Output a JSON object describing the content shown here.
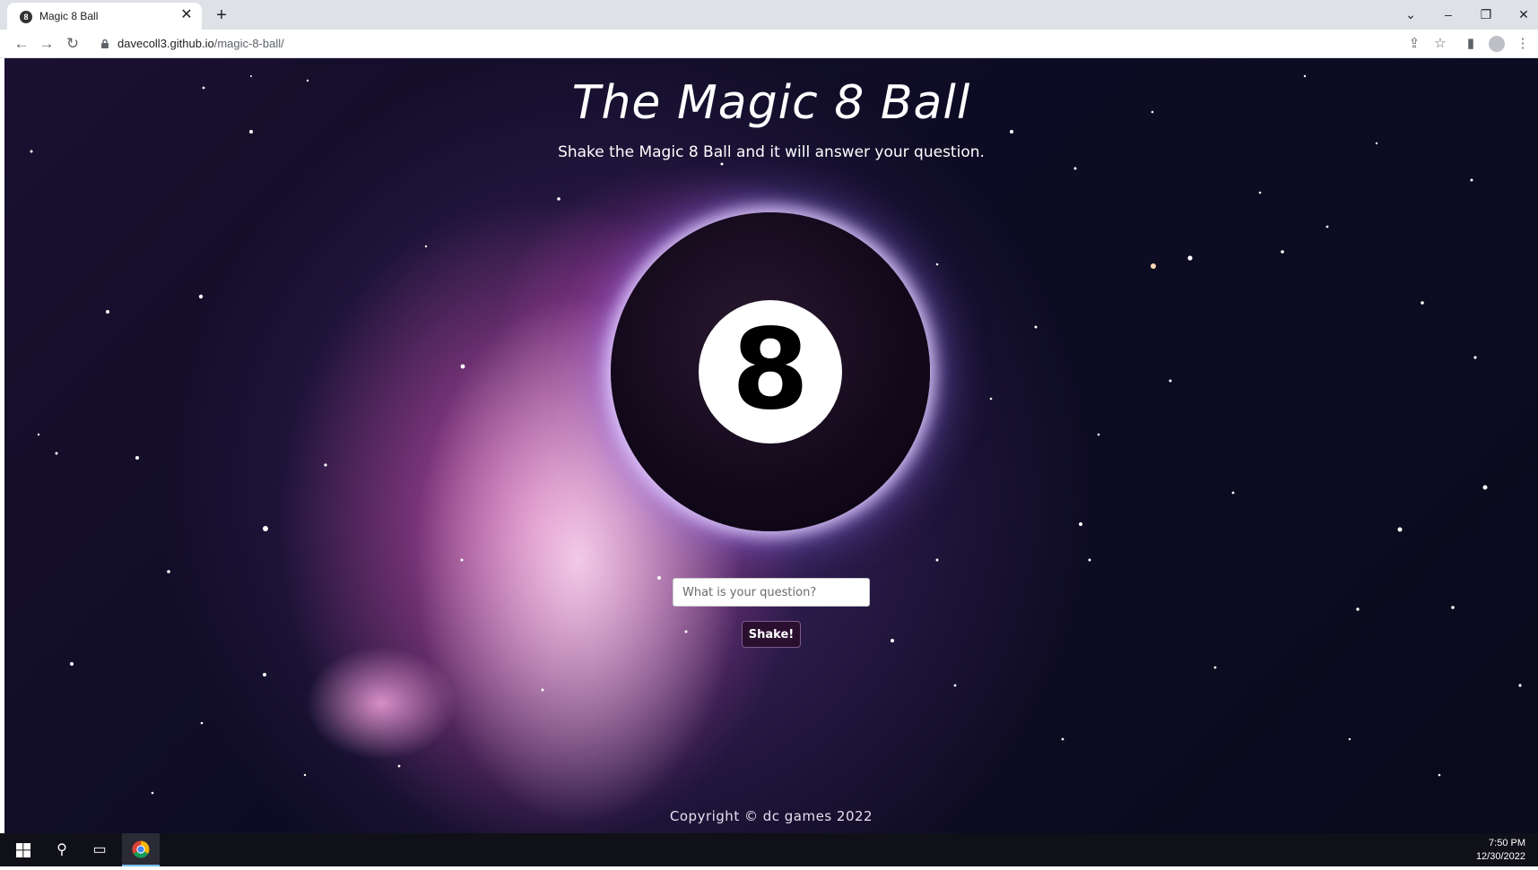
{
  "browser": {
    "tab_title": "Magic 8 Ball",
    "tab_favicon": "8",
    "url_host": "davecoll3.github.io",
    "url_path": "/magic-8-ball/"
  },
  "page": {
    "title": "The Magic 8 Ball",
    "subtitle": "Shake the Magic 8 Ball and it will answer your question.",
    "ball_number": "8",
    "question_placeholder": "What is your question?",
    "question_value": "",
    "shake_label": "Shake!",
    "copyright": "Copyright © dc games 2022"
  },
  "taskbar": {
    "time": "7:50 PM",
    "date": "12/30/2022"
  },
  "colors": {
    "button_bg": "#2a0f2e",
    "taskbar_bg": "#101018",
    "tab_strip_bg": "#dee1e6"
  },
  "icons": {
    "back": "arrow-left-icon",
    "forward": "arrow-right-icon",
    "reload": "reload-icon",
    "lock": "lock-icon",
    "share": "share-icon",
    "bookmark": "star-icon",
    "side_panel": "side-panel-icon",
    "profile": "profile-icon",
    "menu": "kebab-menu-icon",
    "start": "windows-start-icon",
    "search": "search-icon",
    "task_view": "task-view-icon",
    "chrome": "chrome-icon"
  }
}
